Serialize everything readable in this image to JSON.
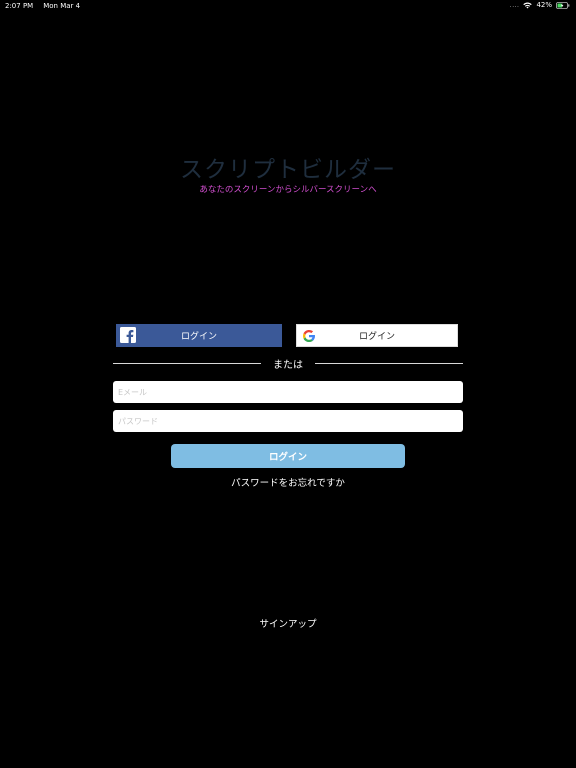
{
  "status_bar": {
    "time": "2:07 PM",
    "date": "Mon Mar 4",
    "signal": "....",
    "battery": "42%",
    "wifi_icon": "wifi-icon",
    "battery_icon": "battery-charging-icon"
  },
  "header": {
    "title": "スクリプトビルダー",
    "subtitle": "あなたのスクリーンからシルバースクリーンへ"
  },
  "social": {
    "facebook_label": "ログイン",
    "facebook_icon": "facebook-icon",
    "facebook_color": "#3b5998",
    "google_label": "ログイン",
    "google_icon": "google-icon"
  },
  "divider": {
    "label": "または"
  },
  "form": {
    "email_placeholder": "Eメール",
    "password_placeholder": "パスワード",
    "login_label": "ログイン",
    "login_color": "#7fbde3",
    "forgot_label": "パスワードをお忘れですか"
  },
  "footer": {
    "signup_label": "サインアップ"
  },
  "colors": {
    "background": "#000000",
    "title": "#1f2e3e",
    "subtitle": "#d24fd0"
  }
}
